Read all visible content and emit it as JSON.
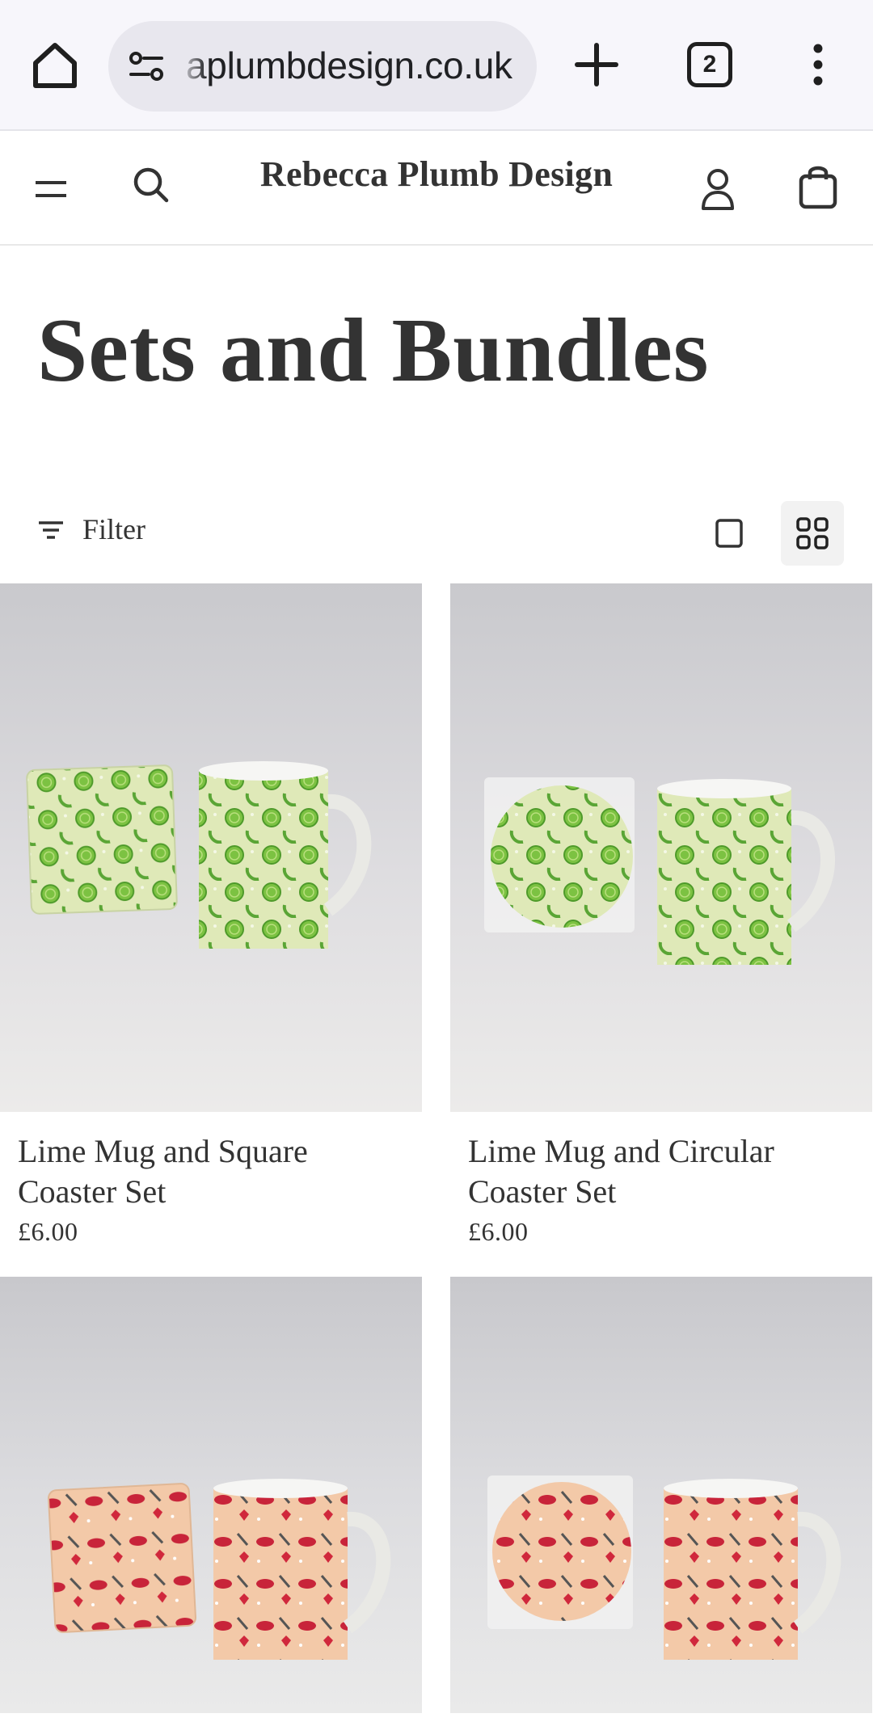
{
  "browser": {
    "url": "aplumbdesign.co.uk",
    "tab_count": "2"
  },
  "store": {
    "brand": "Rebecca Plumb Design"
  },
  "collection": {
    "title": "Sets and Bundles",
    "filter_label": "Filter"
  },
  "products": [
    {
      "title": "Lime Mug and Square Coaster Set",
      "price": "£6.00",
      "theme": "lime",
      "coaster": "square"
    },
    {
      "title": "Lime Mug and Circular Coaster Set",
      "price": "£6.00",
      "theme": "lime",
      "coaster": "circular"
    },
    {
      "title": "",
      "price": "",
      "theme": "lips",
      "coaster": "square"
    },
    {
      "title": "",
      "price": "",
      "theme": "lips",
      "coaster": "circular"
    }
  ],
  "colors": {
    "text": "#333333",
    "browser_bg": "#f7f6fb",
    "url_pill": "#e8e7ee",
    "lime_bg": "#dfe9b8",
    "lime_fruit": "#7cc242",
    "lips_bg": "#f3c9a8",
    "lips_red": "#c8243a"
  },
  "icons": [
    "home-icon",
    "site-info-icon",
    "plus-icon",
    "tabs-icon",
    "more-vert-icon",
    "hamburger-icon",
    "search-icon",
    "account-icon",
    "cart-icon",
    "filter-icon",
    "single-view-icon",
    "grid-view-icon"
  ]
}
